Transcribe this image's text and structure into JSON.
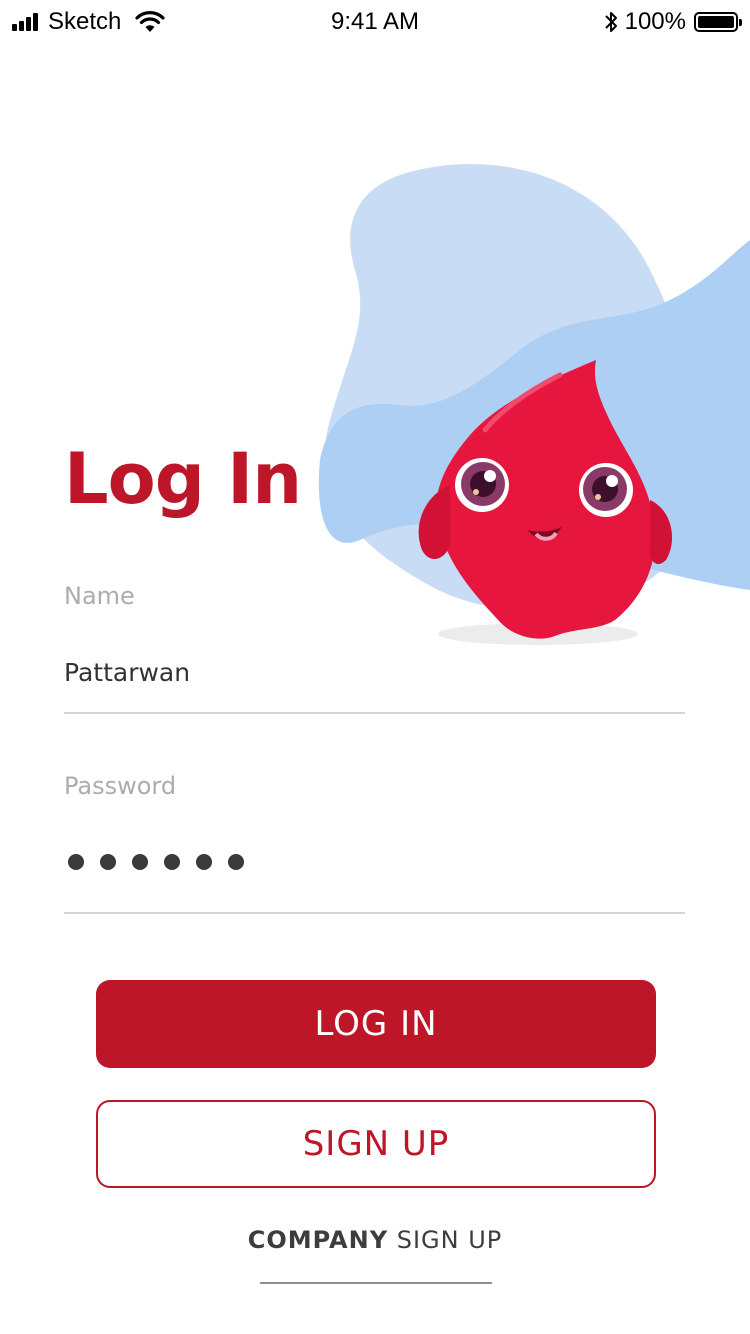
{
  "status_bar": {
    "carrier": "Sketch",
    "time": "9:41 AM",
    "battery": "100%"
  },
  "login": {
    "title": "Log In",
    "name_label": "Name",
    "name_value": "Pattarwan",
    "password_label": "Password",
    "password_length": 6,
    "login_button": "LOG IN",
    "signup_button": "SIGN UP",
    "company_bold": "COMPANY",
    "company_rest": "SIGN UP"
  },
  "colors": {
    "brand": "#bc1628",
    "blob_light": "#c8dcf5",
    "blob_dark": "#aecff4",
    "mascot": "#e6163f"
  },
  "icons": [
    "signal-icon",
    "wifi-icon",
    "bluetooth-icon",
    "battery-icon",
    "mascot-illustration"
  ]
}
